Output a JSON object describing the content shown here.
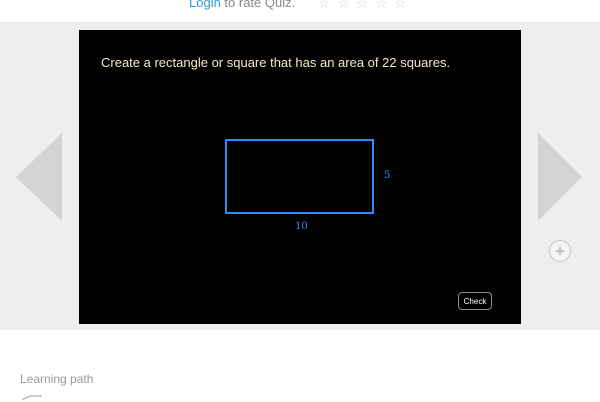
{
  "rating": {
    "login_label": "Login",
    "prompt_text": " to rate Quiz.",
    "stars": [
      "☆",
      "☆",
      "☆",
      "☆",
      "☆"
    ]
  },
  "quiz": {
    "question": "Create a rectangle or square that has an area of 22 squares.",
    "shape": {
      "width_label": "10",
      "height_label": "5"
    },
    "check_label": "Check"
  },
  "sidebar": {
    "learning_path_label": "Learning path"
  },
  "icons": {
    "prev": "arrow-left-icon",
    "next": "arrow-right-icon",
    "expand": "expand-icon",
    "path": "path-icon"
  },
  "colors": {
    "link": "#2a9fd6",
    "shape_outline": "#2f8cff",
    "stage_background": "#000000",
    "question_text": "#f4e9c8"
  }
}
